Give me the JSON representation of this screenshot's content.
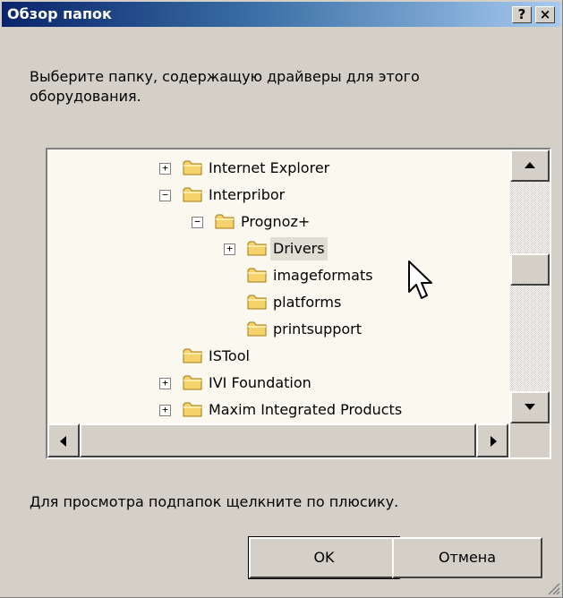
{
  "dialog": {
    "title": "Обзор папок",
    "help_label": "?",
    "close_label": "×",
    "prompt": "Выберите папку, содержащую драйверы для этого оборудования.",
    "hint": "Для просмотра подпапок щелкните по плюсику.",
    "ok_label": "OK",
    "cancel_label": "Отмена"
  },
  "tree": {
    "nodes": [
      {
        "label": "Internet Explorer",
        "expander": "+"
      },
      {
        "label": "Interpribor",
        "expander": "−"
      },
      {
        "label": "Prognoz+",
        "expander": "−"
      },
      {
        "label": "Drivers",
        "expander": "+",
        "selected": true
      },
      {
        "label": "imageformats",
        "expander": ""
      },
      {
        "label": "platforms",
        "expander": ""
      },
      {
        "label": "printsupport",
        "expander": ""
      },
      {
        "label": "ISTool",
        "expander": ""
      },
      {
        "label": "IVI Foundation",
        "expander": "+"
      },
      {
        "label": "Maxim Integrated Products",
        "expander": "+"
      }
    ]
  },
  "icons": {
    "folder": "folder-icon",
    "scroll_up": "arrow-up-icon",
    "scroll_down": "arrow-down-icon",
    "scroll_left": "arrow-left-icon",
    "scroll_right": "arrow-right-icon",
    "cursor": "mouse-pointer-icon"
  },
  "colors": {
    "titlebar_start": "#0a246a",
    "titlebar_end": "#a6caf0",
    "face": "#d4d0c8",
    "tree_bg": "#fbf8ef",
    "folder": "#f6d36a"
  }
}
